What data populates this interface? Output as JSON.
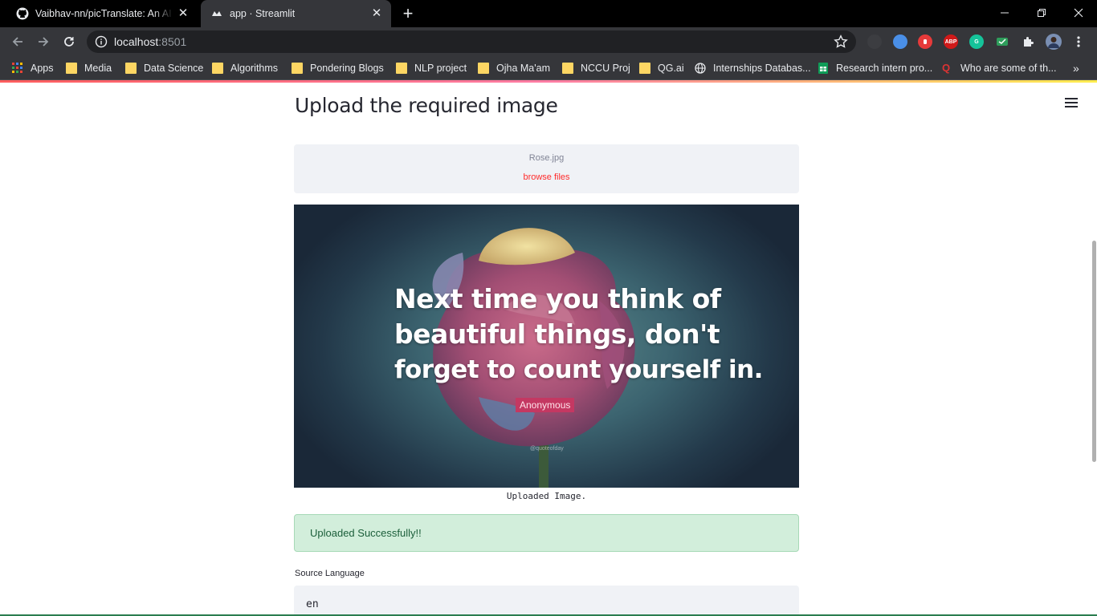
{
  "browser": {
    "tabs": [
      {
        "title": "Vaibhav-nn/picTranslate: An AI ba",
        "icon": "github-icon"
      },
      {
        "title": "app · Streamlit",
        "icon": "streamlit-icon",
        "active": true
      }
    ],
    "address": {
      "host": "localhost",
      "port": ":8501"
    },
    "bookmarks": [
      {
        "label": "Apps",
        "icon": "apps-grid-icon"
      },
      {
        "label": "Media",
        "icon": "folder-icon"
      },
      {
        "label": "Data Science",
        "icon": "folder-icon"
      },
      {
        "label": "Algorithms",
        "icon": "folder-icon"
      },
      {
        "label": "Pondering Blogs",
        "icon": "folder-icon"
      },
      {
        "label": "NLP project",
        "icon": "folder-icon"
      },
      {
        "label": "Ojha Ma'am",
        "icon": "folder-icon"
      },
      {
        "label": "NCCU Proj",
        "icon": "folder-icon"
      },
      {
        "label": "QG.ai",
        "icon": "folder-icon"
      },
      {
        "label": "Internships Databas...",
        "icon": "globe-icon"
      },
      {
        "label": "Research intern pro...",
        "icon": "sheets-icon"
      },
      {
        "label": "Who are some of th...",
        "icon": "quora-icon"
      }
    ],
    "extensions": {
      "abp": "ABP"
    }
  },
  "app": {
    "heading": "Upload the required image",
    "uploader": {
      "file_name": "Rose.jpg",
      "browse_label": "browse files"
    },
    "image": {
      "quote_line1": "Next time you think of",
      "quote_line2": "beautiful things, don't",
      "quote_line3": "forget to count yourself in.",
      "author": "Anonymous",
      "watermark": "@quoteofday",
      "caption": "Uploaded Image."
    },
    "success_message": "Uploaded Successfully!!",
    "source_language": {
      "label": "Source Language",
      "value": "en"
    }
  },
  "colors": {
    "streamlit_primary": "#ff2b2b",
    "success_bg": "#d2eedb",
    "success_text": "#1b5e3a",
    "widget_bg": "#f0f2f6"
  }
}
